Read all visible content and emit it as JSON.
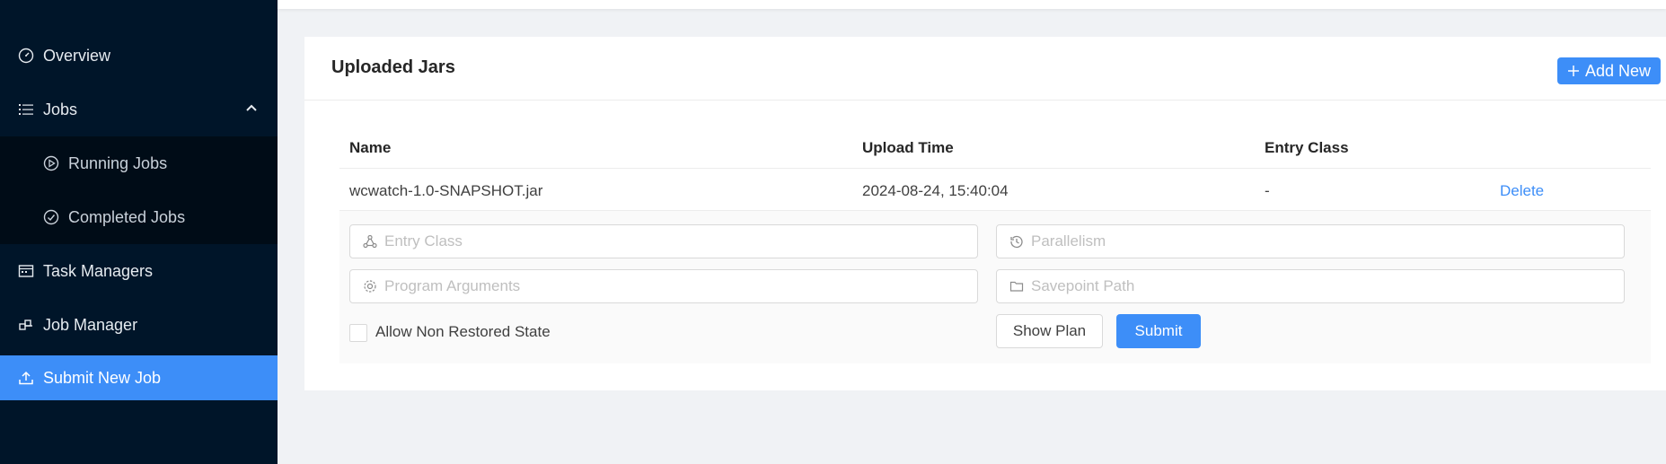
{
  "sidebar": {
    "items": [
      {
        "label": "Overview",
        "icon": "dashboard-icon"
      },
      {
        "label": "Jobs",
        "icon": "list-icon"
      },
      {
        "label": "Running Jobs",
        "icon": "play-circle-icon"
      },
      {
        "label": "Completed Jobs",
        "icon": "check-circle-icon"
      },
      {
        "label": "Task Managers",
        "icon": "schedule-icon"
      },
      {
        "label": "Job Manager",
        "icon": "build-icon"
      },
      {
        "label": "Submit New Job",
        "icon": "upload-icon"
      }
    ],
    "active_color": "#3d8ef8",
    "bg_color": "#001529"
  },
  "card": {
    "title": "Uploaded Jars",
    "add_button": "Add New"
  },
  "table": {
    "columns": [
      "Name",
      "Upload Time",
      "Entry Class"
    ],
    "rows": [
      {
        "name": "wcwatch-1.0-SNAPSHOT.jar",
        "upload_time": "2024-08-24, 15:40:04",
        "entry_class": "-",
        "action": "Delete"
      }
    ]
  },
  "form": {
    "entry_class_placeholder": "Entry Class",
    "parallelism_placeholder": "Parallelism",
    "program_args_placeholder": "Program Arguments",
    "savepoint_placeholder": "Savepoint Path",
    "allow_non_restored_label": "Allow Non Restored State",
    "show_plan_button": "Show Plan",
    "submit_button": "Submit"
  }
}
